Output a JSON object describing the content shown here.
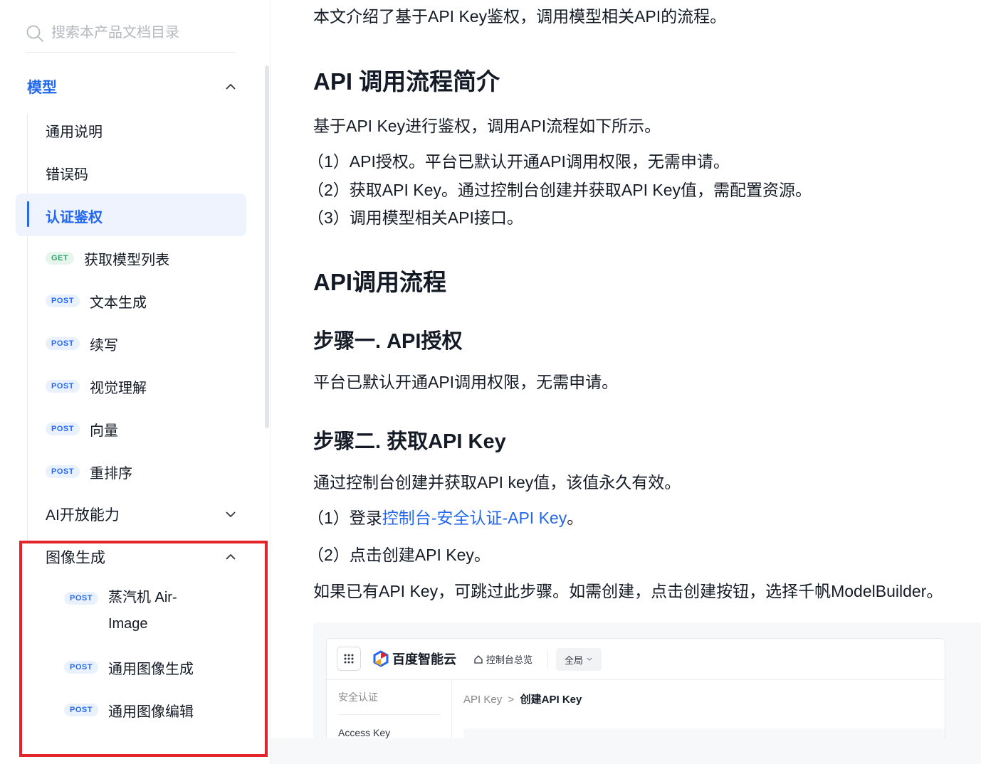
{
  "sidebar": {
    "search_placeholder": "搜索本产品文档目录",
    "groups": {
      "model": "模型",
      "ai_open": "AI开放能力",
      "image_gen": "图像生成"
    },
    "items": [
      {
        "label": "通用说明"
      },
      {
        "label": "错误码"
      },
      {
        "label": "认证鉴权",
        "selected": true
      },
      {
        "method": "GET",
        "label": "获取模型列表"
      },
      {
        "method": "POST",
        "label": "文本生成"
      },
      {
        "method": "POST",
        "label": "续写"
      },
      {
        "method": "POST",
        "label": "视觉理解"
      },
      {
        "method": "POST",
        "label": "向量"
      },
      {
        "method": "POST",
        "label": "重排序"
      }
    ],
    "image_items": [
      {
        "method": "POST",
        "label_line1": "蒸汽机 Air-",
        "label_line2": "Image"
      },
      {
        "method": "POST",
        "label": "通用图像生成"
      },
      {
        "method": "POST",
        "label": "通用图像编辑"
      }
    ]
  },
  "content": {
    "intro": "本文介绍了基于API Key鉴权，调用模型相关API的流程。",
    "h_overview": "API 调用流程简介",
    "overview_text": "基于API Key进行鉴权，调用API流程如下所示。",
    "overview_steps": [
      "（1）API授权。平台已默认开通API调用权限，无需申请。",
      "（2）获取API Key。通过控制台创建并获取API Key值，需配置资源。",
      "（3）调用模型相关API接口。"
    ],
    "h_flow": "API调用流程",
    "h_step1": "步骤一. API授权",
    "step1_text": "平台已默认开通API调用权限，无需申请。",
    "h_step2": "步骤二. 获取API Key",
    "step2_text": "通过控制台创建并获取API key值，该值永久有效。",
    "step2_item1_prefix": "（1）登录",
    "step2_item1_link": "控制台-安全认证-API Key",
    "step2_item1_suffix": "。",
    "step2_item2": "（2）点击创建API Key。",
    "step2_note": "如果已有API Key，可跳过此步骤。如需创建，点击创建按钮，选择千帆ModelBuilder。",
    "screenshot": {
      "logo": "百度智能云",
      "console": "控制台总览",
      "region": "全局",
      "side_title": "安全认证",
      "side_item": "Access Key",
      "crumb1": "API Key",
      "crumb_sep": ">",
      "crumb2": "创建API Key"
    }
  },
  "colors": {
    "accent": "#2468f2",
    "highlight": "#e3242b",
    "get_badge": "#30a46c"
  }
}
